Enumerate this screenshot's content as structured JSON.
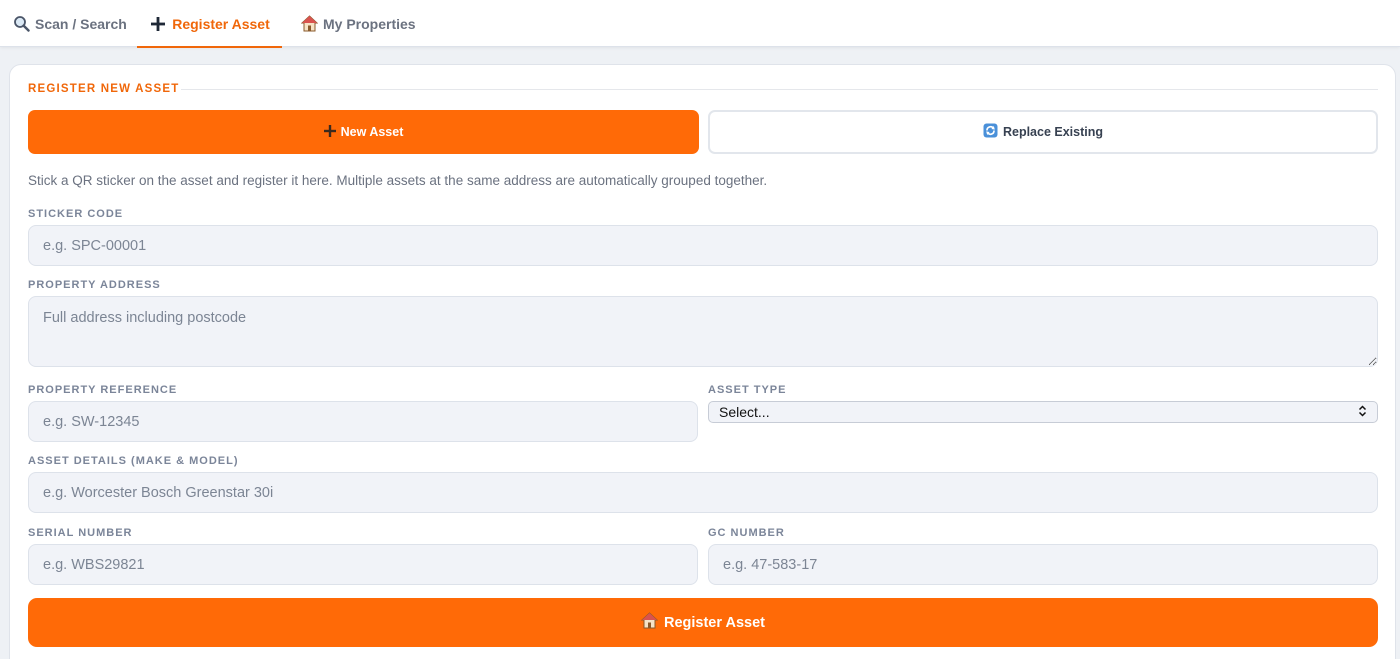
{
  "tabs": [
    {
      "label": "Scan / Search",
      "icon": "magnifier-icon"
    },
    {
      "label": "Register Asset",
      "icon": "plus-icon",
      "active": true
    },
    {
      "label": "My Properties",
      "icon": "house-icon"
    }
  ],
  "section": {
    "title": "REGISTER NEW ASSET"
  },
  "mode": {
    "new_label": "New Asset",
    "replace_label": "Replace Existing"
  },
  "hint": "Stick a QR sticker on the asset and register it here. Multiple assets at the same address are automatically grouped together.",
  "fields": {
    "sticker_code": {
      "label": "STICKER CODE",
      "placeholder": "e.g. SPC-00001"
    },
    "property_address": {
      "label": "PROPERTY ADDRESS",
      "placeholder": "Full address including postcode"
    },
    "property_reference": {
      "label": "PROPERTY REFERENCE",
      "placeholder": "e.g. SW-12345"
    },
    "asset_type": {
      "label": "ASSET TYPE",
      "selected": "Select..."
    },
    "asset_details": {
      "label": "ASSET DETAILS (MAKE & MODEL)",
      "placeholder": "e.g. Worcester Bosch Greenstar 30i"
    },
    "serial_number": {
      "label": "SERIAL NUMBER",
      "placeholder": "e.g. WBS29821"
    },
    "gc_number": {
      "label": "GC NUMBER",
      "placeholder": "e.g. 47-583-17"
    }
  },
  "submit_label": "Register Asset",
  "colors": {
    "accent": "#ff6a07",
    "accent_text": "#f0670a",
    "field_bg": "#f1f3f8"
  }
}
